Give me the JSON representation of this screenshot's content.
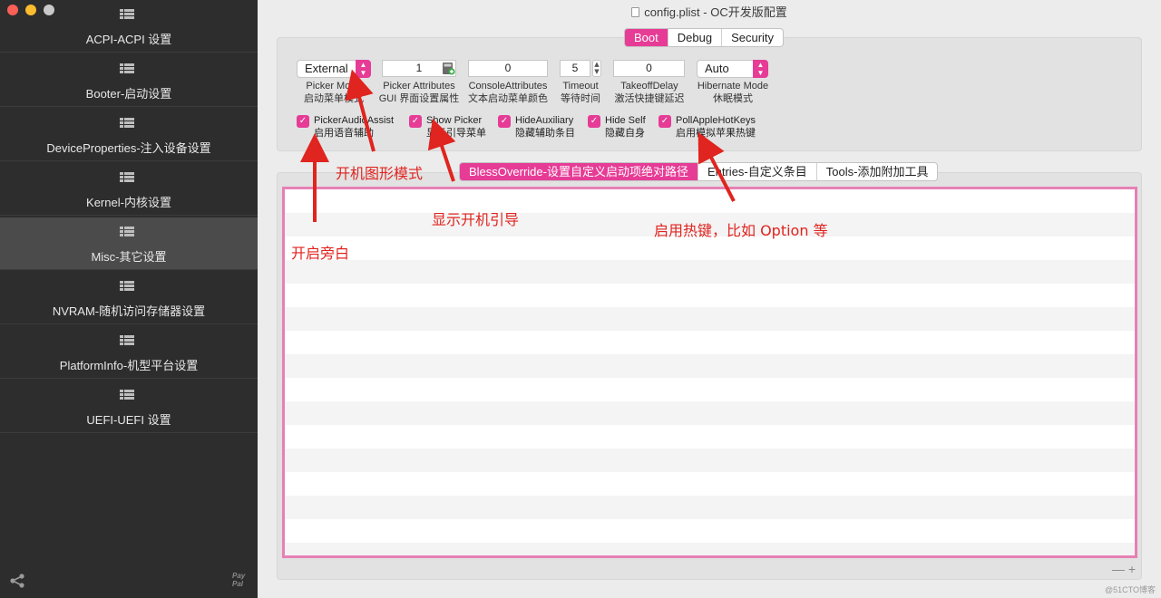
{
  "window": {
    "title": "config.plist - OC开发版配置"
  },
  "sidebar": {
    "items": [
      {
        "label": "ACPI-ACPI 设置"
      },
      {
        "label": "Booter-启动设置"
      },
      {
        "label": "DeviceProperties-注入设备设置"
      },
      {
        "label": "Kernel-内核设置"
      },
      {
        "label": "Misc-其它设置"
      },
      {
        "label": "NVRAM-随机访问存储器设置"
      },
      {
        "label": "PlatformInfo-机型平台设置"
      },
      {
        "label": "UEFI-UEFI 设置"
      }
    ],
    "active_index": 4,
    "paypal": "Pay Pal"
  },
  "top_tabs": [
    {
      "label": "Boot"
    },
    {
      "label": "Debug"
    },
    {
      "label": "Security"
    }
  ],
  "controls": {
    "picker_mode": {
      "value": "External",
      "caption_en": "Picker Mode",
      "caption_cn": "启动菜单模式"
    },
    "picker_attributes": {
      "value": "1",
      "caption_en": "Picker Attributes",
      "caption_cn": "GUI 界面设置属性"
    },
    "console_attributes": {
      "value": "0",
      "caption_en": "ConsoleAttributes",
      "caption_cn": "文本启动菜单颜色"
    },
    "timeout": {
      "value": "5",
      "caption_en": "Timeout",
      "caption_cn": "等待时间"
    },
    "takeoff_delay": {
      "value": "0",
      "caption_en": "TakeoffDelay",
      "caption_cn": "激活快捷键延迟"
    },
    "hibernate_mode": {
      "value": "Auto",
      "caption_en": "Hibernate Mode",
      "caption_cn": "休眠模式"
    }
  },
  "checkboxes": [
    {
      "label_en": "PickerAudioAssist",
      "label_cn": "启用语音辅助",
      "checked": true
    },
    {
      "label_en": "Show Picker",
      "label_cn": "显示引导菜单",
      "checked": true
    },
    {
      "label_en": "HideAuxiliary",
      "label_cn": "隐藏辅助条目",
      "checked": true
    },
    {
      "label_en": "Hide Self",
      "label_cn": "隐藏自身",
      "checked": true
    },
    {
      "label_en": "PollAppleHotKeys",
      "label_cn": "启用模拟苹果热键",
      "checked": true
    }
  ],
  "sub_tabs": [
    {
      "label": "BlessOverride-设置自定义启动项绝对路径"
    },
    {
      "label": "Entries-自定义条目"
    },
    {
      "label": "Tools-添加附加工具"
    }
  ],
  "table": {
    "row_count": 16
  },
  "footer": {
    "minus": "—",
    "plus": "+"
  },
  "annotations": {
    "picker_mode_note": "开机图形模式",
    "show_picker_note": "显示开机引导",
    "audio_note": "开启旁白",
    "hotkeys_note": "启用热键，比如 Option 等"
  },
  "watermark": "@51CTO博客",
  "colors": {
    "accent": "#e63c96",
    "annotation": "#e0241f",
    "sidebar_bg": "#2d2d2d"
  }
}
